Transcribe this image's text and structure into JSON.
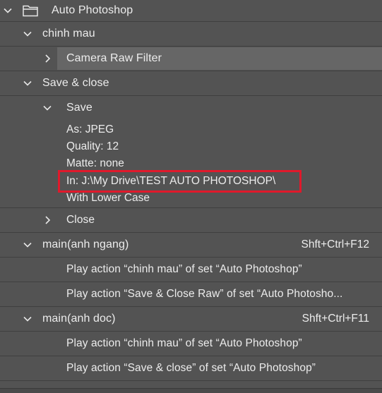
{
  "set": {
    "name": "Auto Photoshop"
  },
  "actions": {
    "chinh_mau": {
      "name": "chinh mau",
      "steps": [
        {
          "label": "Camera Raw Filter"
        }
      ]
    },
    "save_close": {
      "name": "Save & close",
      "save_step": {
        "label": "Save",
        "details": {
          "as": "As: JPEG",
          "quality": "Quality: 12",
          "matte": "Matte: none",
          "in": "In: J:\\My Drive\\TEST AUTO PHOTOSHOP\\",
          "case": "With Lower Case"
        }
      },
      "close_step": {
        "label": "Close"
      }
    },
    "main_ngang": {
      "name": "main(anh ngang)",
      "shortcut": "Shft+Ctrl+F12",
      "steps": [
        {
          "label": "Play action “chinh mau” of set “Auto Photoshop”"
        },
        {
          "label": "Play action “Save & Close Raw” of set “Auto Photosho..."
        }
      ]
    },
    "main_doc": {
      "name": "main(anh doc)",
      "shortcut": "Shft+Ctrl+F11",
      "steps": [
        {
          "label": "Play action “chinh mau” of set “Auto Photoshop”"
        },
        {
          "label": "Play action “Save & close” of set “Auto Photoshop”"
        }
      ]
    }
  },
  "icons": {
    "expanded": "chevron-down-icon",
    "collapsed": "chevron-right-icon",
    "folder": "folder-icon"
  },
  "colors": {
    "panel_bg": "#535353",
    "selected_row_bg": "#666666",
    "highlight_border": "#e0192b",
    "text": "#ececec"
  }
}
